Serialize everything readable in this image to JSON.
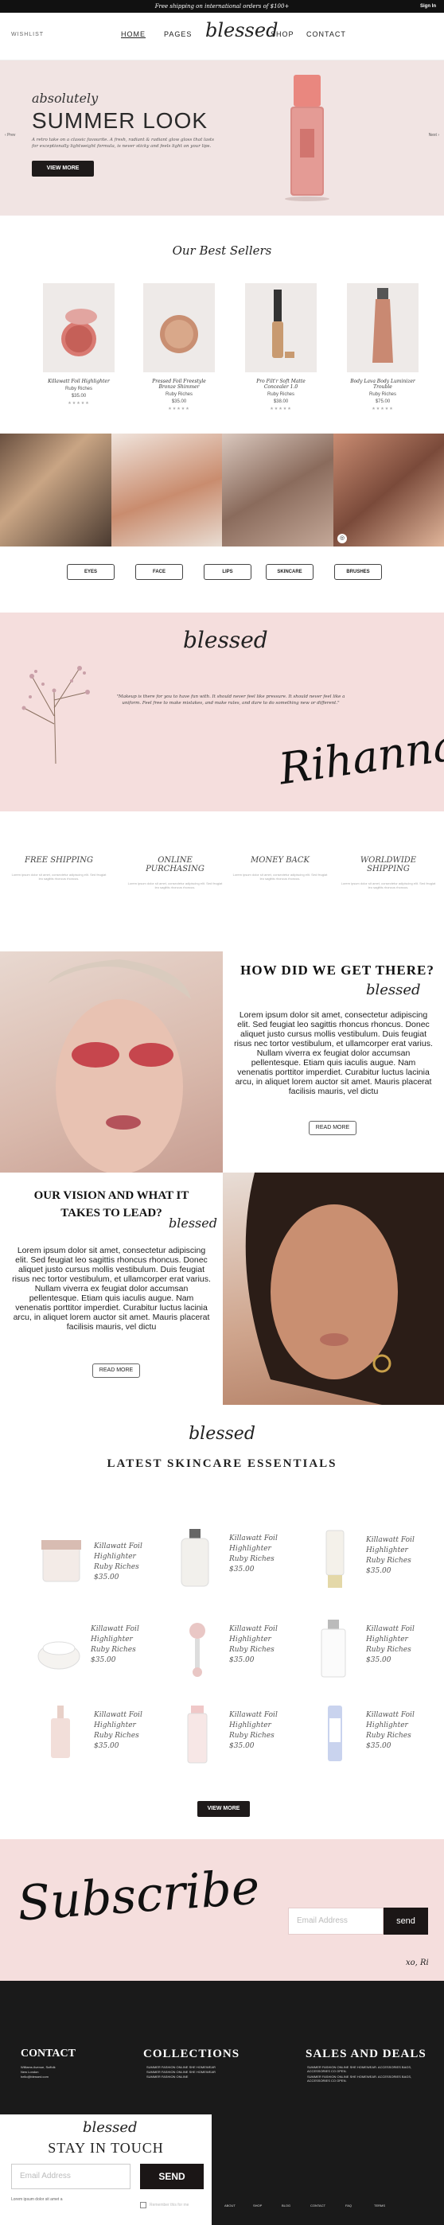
{
  "topbar": {
    "promo": "Free shipping on international orders of $100+",
    "signin": "Sign In"
  },
  "nav": {
    "wishlist": "WISHLIST",
    "home": "HOME",
    "pages": "PAGES",
    "logo": "blessed",
    "shop": "SHOP",
    "contact": "CONTACT"
  },
  "hero": {
    "script": "absolutely",
    "title": "SUMMER LOOK",
    "body": "A retro take on a classic favourite. A fresh, radiant & radiant glow gloss that lasts for exceptionally lightweight formula, is never sticky and feels light on your lips.",
    "cta": "VIEW MORE",
    "prev": "Prev",
    "next": "Next"
  },
  "bestsellers": {
    "title": "Our Best Sellers",
    "items": [
      {
        "name": "Killawatt Foil Highlighter",
        "sub": "Ruby Riches",
        "price": "$35.00",
        "stars": "★★★★★"
      },
      {
        "name": "Pressed Foil Freestyle Bronze Shimmer",
        "sub": "Ruby Riches",
        "price": "$35.00",
        "stars": "★★★★★"
      },
      {
        "name": "Pro Filt'r Soft Matte Concealer 1.0",
        "sub": "Ruby Riches",
        "price": "$38.00",
        "stars": "★★★★★"
      },
      {
        "name": "Body Lava Body Luminizer Trouble",
        "sub": "Ruby Riches",
        "price": "$75.00",
        "stars": "★★★★★"
      }
    ]
  },
  "categories": [
    "EYES",
    "FACE",
    "LIPS",
    "SKINCARE",
    "BRUSHES"
  ],
  "quote": {
    "logo": "blessed",
    "text": "\"Makeup is there for you to have fun with. It should never feel like pressure. It should never feel like a uniform. Feel free to make mistakes, and make rules, and dare to do something new or different.\"",
    "signature": "Rihanna"
  },
  "features": [
    {
      "title": "FREE SHIPPING",
      "desc": "Lorem ipsum dolor sit amet, consectetur adipiscing elit. Sed feugiat leo sagittis rhoncus rhoncus."
    },
    {
      "title": "ONLINE PURCHASING",
      "desc": "Lorem ipsum dolor sit amet, consectetur adipiscing elit. Sed feugiat leo sagittis rhoncus rhoncus."
    },
    {
      "title": "MONEY BACK",
      "desc": "Lorem ipsum dolor sit amet, consectetur adipiscing elit. Sed feugiat leo sagittis rhoncus rhoncus."
    },
    {
      "title": "WORLDWIDE SHIPPING",
      "desc": "Lorem ipsum dolor sit amet, consectetur adipiscing elit. Sed feugiat leo sagittis rhoncus rhoncus."
    }
  ],
  "story1": {
    "title": "HOW DID WE GET THERE?",
    "script": "blessed",
    "body": "Lorem ipsum dolor sit amet, consectetur adipiscing elit. Sed feugiat leo sagittis rhoncus rhoncus. Donec aliquet justo cursus mollis vestibulum. Duis feugiat risus nec tortor vestibulum, et ullamcorper erat varius. Nullam viverra ex feugiat dolor accumsan pellentesque. Etiam quis iaculis augue. Nam venenatis porttitor imperdiet. Curabitur luctus lacinia arcu, in aliquet lorem auctor sit amet. Mauris placerat facilisis mauris, vel dictu",
    "cta": "READ MORE"
  },
  "story2": {
    "title": "OUR VISION AND WHAT IT TAKES TO LEAD?",
    "script": "blessed",
    "body": "Lorem ipsum dolor sit amet, consectetur adipiscing elit. Sed feugiat leo sagittis rhoncus rhoncus. Donec aliquet justo cursus mollis vestibulum. Duis feugiat risus nec tortor vestibulum, et ullamcorper erat varius. Nullam viverra ex feugiat dolor accumsan pellentesque. Etiam quis iaculis augue. Nam venenatis porttitor imperdiet. Curabitur luctus lacinia arcu, in aliquet lorem auctor sit amet. Mauris placerat facilisis mauris, vel dictu",
    "cta": "READ MORE"
  },
  "skincare": {
    "script": "blessed",
    "title": "LATEST SKINCARE ESSENTIALS",
    "items": [
      {
        "name": "Killawatt Foil Highlighter",
        "sub": "Ruby Riches",
        "price": "$35.00"
      },
      {
        "name": "Killawatt Foil Highlighter",
        "sub": "Ruby Riches",
        "price": "$35.00"
      },
      {
        "name": "Killawatt Foil Highlighter",
        "sub": "Ruby Riches",
        "price": "$35.00"
      },
      {
        "name": "Killawatt Foil Highlighter",
        "sub": "Ruby Riches",
        "price": "$35.00"
      },
      {
        "name": "Killawatt Foil Highlighter",
        "sub": "Ruby Riches",
        "price": "$35.00"
      },
      {
        "name": "Killawatt Foil Highlighter",
        "sub": "Ruby Riches",
        "price": "$35.00"
      },
      {
        "name": "Killawatt Foil Highlighter",
        "sub": "Ruby Riches",
        "price": "$35.00"
      },
      {
        "name": "Killawatt Foil Highlighter",
        "sub": "Ruby Riches",
        "price": "$35.00"
      },
      {
        "name": "Killawatt Foil Highlighter",
        "sub": "Ruby Riches",
        "price": "$35.00"
      }
    ],
    "cta": "VIEW MORE"
  },
  "subscribe": {
    "title": "Subscribe",
    "placeholder": "Email Address",
    "button": "send",
    "signoff": "xo, Ri"
  },
  "footer": {
    "contact": {
      "title": "CONTACT",
      "lines": [
        "Williams Avenue, Suffolk",
        "New London",
        "hello@blessed.com"
      ]
    },
    "collections": {
      "title": "COLLECTIONS",
      "lines": [
        "SUMMER FASHION ONLINE SHE HOMEWEAR",
        "SUMMER FASHION ONLINE SHE HOMEWEAR",
        "SUMMER FASHION ONLINE"
      ]
    },
    "sales": {
      "title": "SALES AND DEALS",
      "lines": [
        "SUMMER FASHION ONLINE SHE HOMEWEAR. ACCESSORIES BAGS, ACCESSORIES CO OPEN.",
        "SUMMER FASHION ONLINE SHE HOMEWEAR. ACCESSORIES BAGS, ACCESSORIES CO OPEN."
      ]
    },
    "newsletter": {
      "script": "blessed",
      "title": "STAY IN TOUCH",
      "placeholder": "Email Address",
      "button": "SEND",
      "note": "Lorem ipsum dolor sit amet a",
      "checkbox": "Remember this for me"
    },
    "links": [
      "ABOUT",
      "SHOP",
      "BLOG",
      "CONTACT",
      "FAQ",
      "TERMS"
    ]
  }
}
